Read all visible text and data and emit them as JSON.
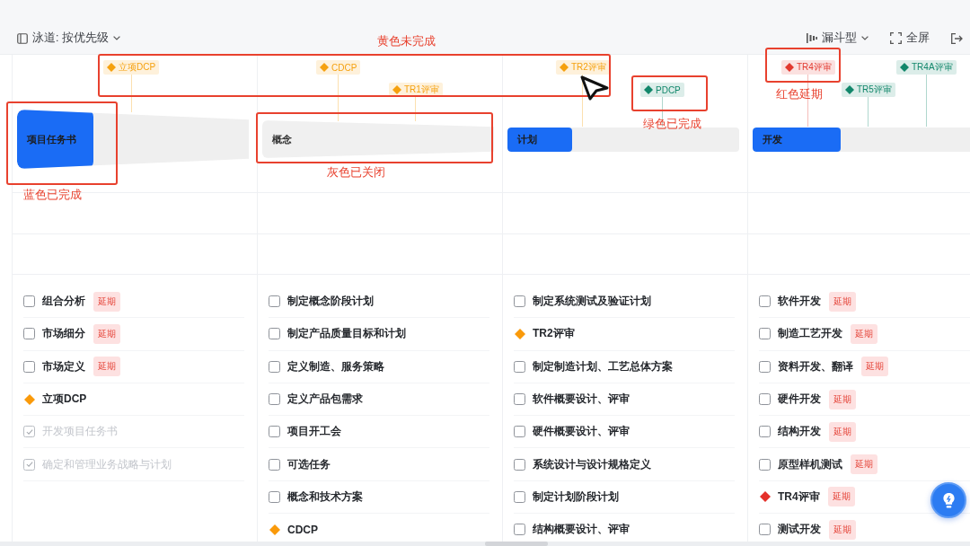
{
  "toolbar": {
    "swimlane_label": "泳道: 按优先级",
    "view_label": "漏斗型",
    "fullscreen_label": "全屏"
  },
  "phases": [
    {
      "name": "项目任务书",
      "closed": false,
      "level": 0.33,
      "milestones": [
        {
          "label": "立项DCP",
          "color": "#f5a10f"
        }
      ],
      "tasks": [
        {
          "kind": "task",
          "label": "组合分析",
          "checked": false,
          "badge": "延期"
        },
        {
          "kind": "task",
          "label": "市场细分",
          "checked": false,
          "badge": "延期"
        },
        {
          "kind": "task",
          "label": "市场定义",
          "checked": false,
          "badge": "延期"
        },
        {
          "kind": "milestone",
          "label": "立项DCP",
          "color": "#fa9a0a"
        },
        {
          "kind": "task",
          "label": "开发项目任务书",
          "checked": true
        },
        {
          "kind": "task",
          "label": "确定和管理业务战略与计划",
          "checked": true
        }
      ]
    },
    {
      "name": "概念",
      "closed": true,
      "milestones": [
        {
          "label": "CDCP",
          "color": "#f5a10f"
        },
        {
          "label": "TR1评审",
          "color": "#f5a10f"
        }
      ],
      "tasks": [
        {
          "kind": "task",
          "label": "制定概念阶段计划",
          "checked": false
        },
        {
          "kind": "task",
          "label": "制定产品质量目标和计划",
          "checked": false
        },
        {
          "kind": "task",
          "label": "定义制造、服务策略",
          "checked": false
        },
        {
          "kind": "task",
          "label": "定义产品包需求",
          "checked": false
        },
        {
          "kind": "task",
          "label": "项目开工会",
          "checked": false
        },
        {
          "kind": "task",
          "label": "可选任务",
          "checked": false
        },
        {
          "kind": "task",
          "label": "概念和技术方案",
          "checked": false
        },
        {
          "kind": "milestone",
          "label": "CDCP",
          "color": "#fa9a0a"
        }
      ]
    },
    {
      "name": "计划",
      "closed": false,
      "level": 0.28,
      "milestones": [
        {
          "label": "TR2评审",
          "color": "#f5a10f"
        },
        {
          "label": "PDCP",
          "color": "#12876b"
        }
      ],
      "tasks": [
        {
          "kind": "task",
          "label": "制定系统测试及验证计划",
          "checked": false
        },
        {
          "kind": "milestone",
          "label": "TR2评审",
          "color": "#fa9a0a"
        },
        {
          "kind": "task",
          "label": "制定制造计划、工艺总体方案",
          "checked": false
        },
        {
          "kind": "task",
          "label": "软件概要设计、评审",
          "checked": false
        },
        {
          "kind": "task",
          "label": "硬件概要设计、评审",
          "checked": false
        },
        {
          "kind": "task",
          "label": "系统设计与设计规格定义",
          "checked": false
        },
        {
          "kind": "task",
          "label": "制定计划阶段计划",
          "checked": false
        },
        {
          "kind": "task",
          "label": "结构概要设计、评审",
          "checked": false
        }
      ]
    },
    {
      "name": "开发",
      "closed": false,
      "level": 0.38,
      "milestones": [
        {
          "label": "TR4评审",
          "color": "#e2392f"
        },
        {
          "label": "TR5评审",
          "color": "#12876b"
        },
        {
          "label": "TR4A评审",
          "color": "#12876b"
        }
      ],
      "tasks": [
        {
          "kind": "task",
          "label": "软件开发",
          "checked": false,
          "badge": "延期"
        },
        {
          "kind": "task",
          "label": "制造工艺开发",
          "checked": false,
          "badge": "延期"
        },
        {
          "kind": "task",
          "label": "资料开发、翻译",
          "checked": false,
          "badge": "延期"
        },
        {
          "kind": "task",
          "label": "硬件开发",
          "checked": false,
          "badge": "延期"
        },
        {
          "kind": "task",
          "label": "结构开发",
          "checked": false,
          "badge": "延期"
        },
        {
          "kind": "task",
          "label": "原型样机测试",
          "checked": false,
          "badge": "延期"
        },
        {
          "kind": "milestone",
          "label": "TR4评审",
          "color": "#e4302a",
          "badge": "延期"
        },
        {
          "kind": "task",
          "label": "测试开发",
          "checked": false,
          "badge": "延期"
        }
      ]
    }
  ],
  "annotations": [
    "黄色未完成",
    "红色延期",
    "绿色已完成",
    "灰色已关闭",
    "蓝色已完成"
  ]
}
